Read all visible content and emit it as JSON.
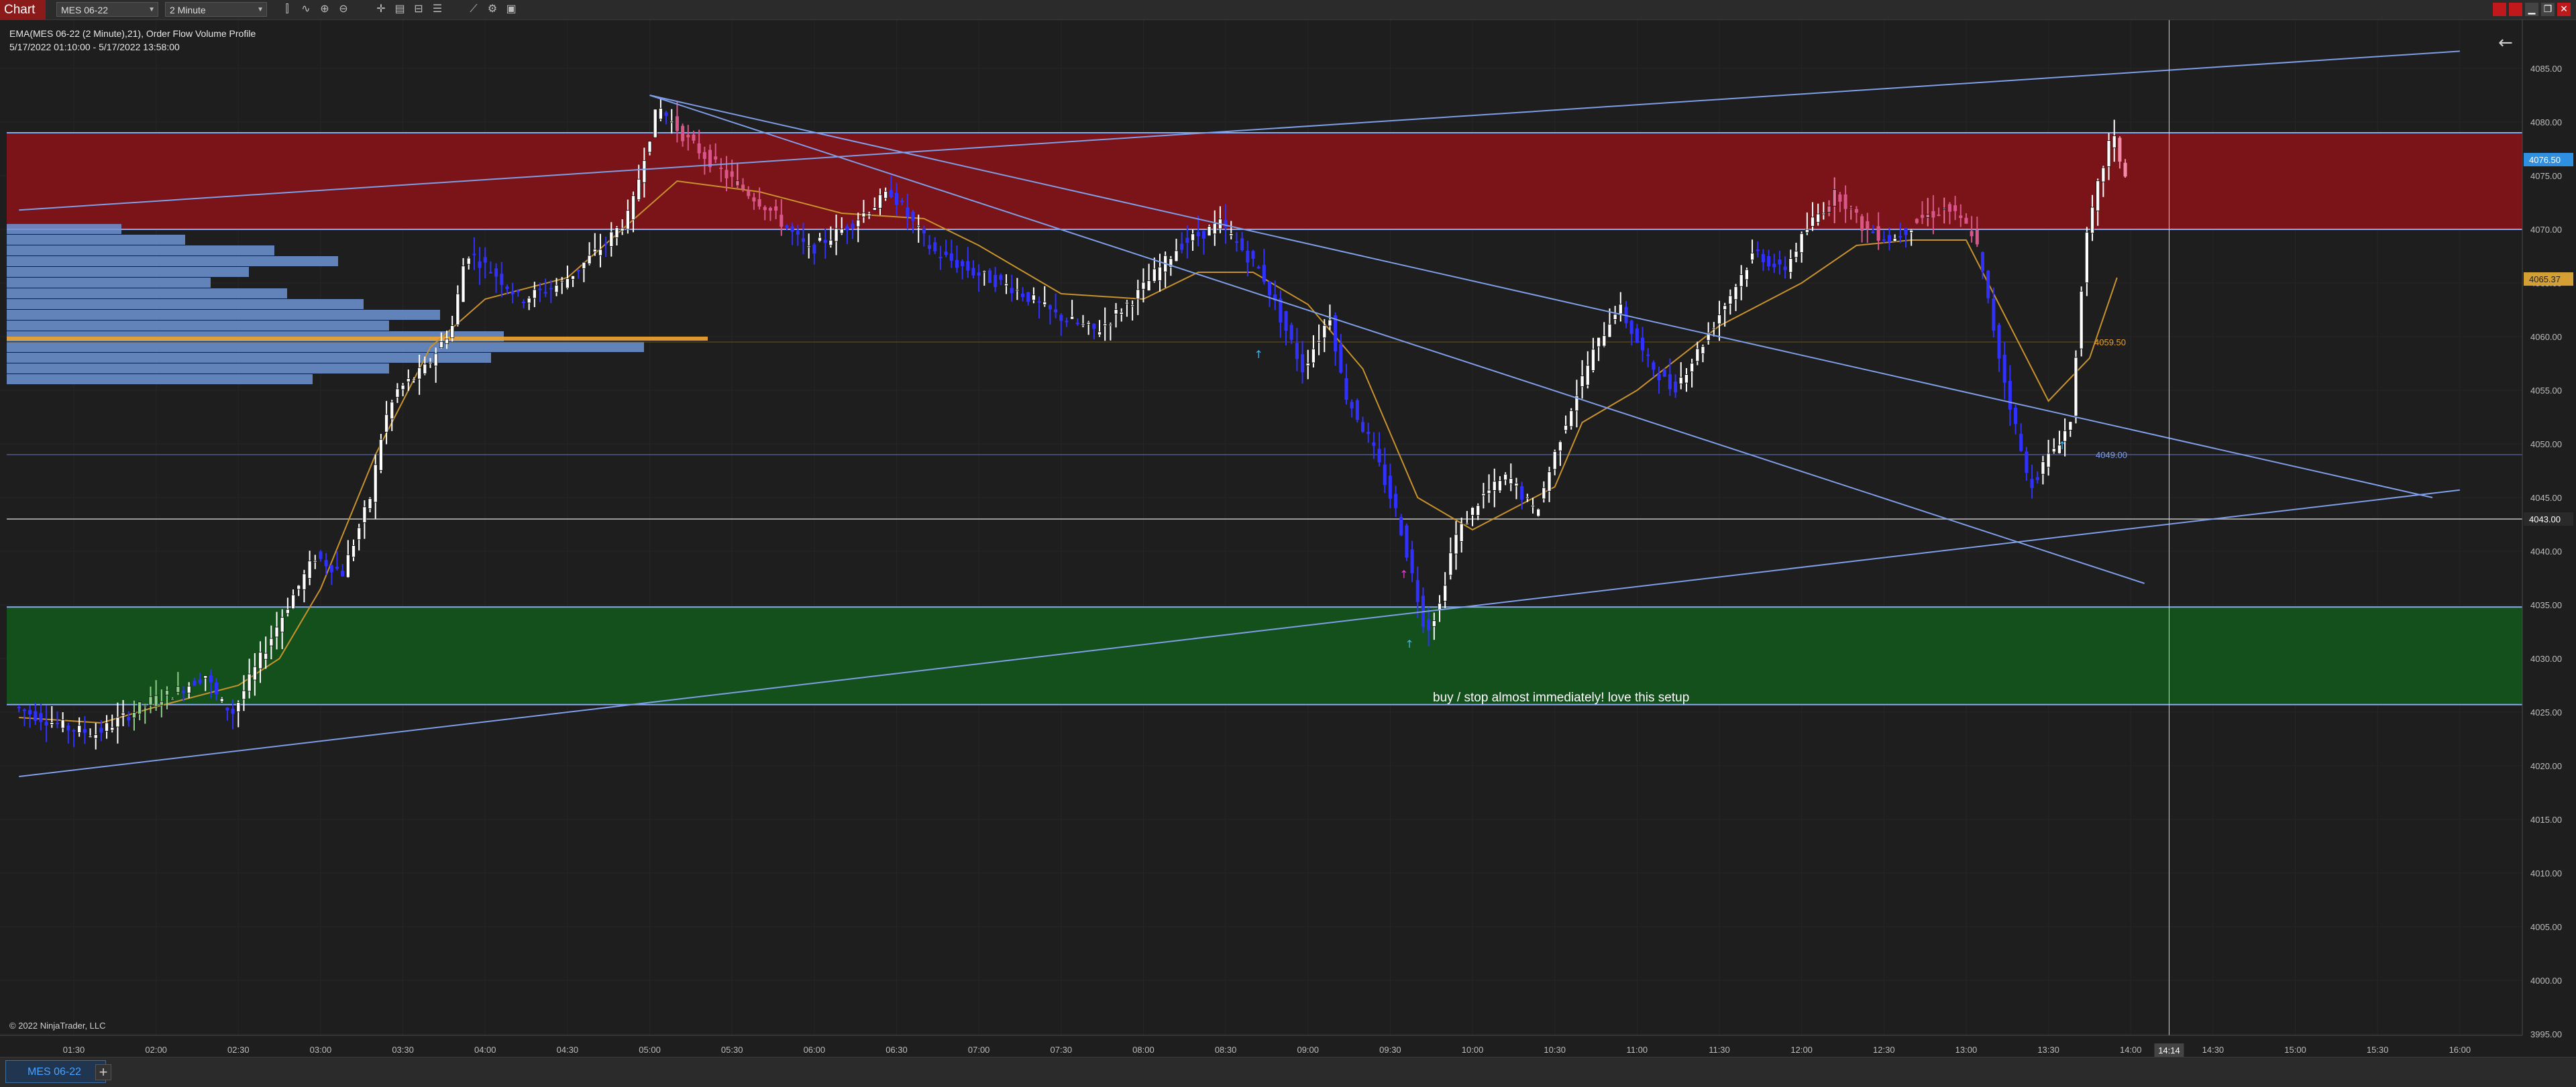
{
  "window": {
    "title": "Chart",
    "instrument": "MES 06-22",
    "interval": "2 Minute"
  },
  "toolbar": {
    "icons": [
      "bar-type-icon",
      "indicators-icon",
      "zoom-in-icon",
      "zoom-out-icon",
      "crosshair-icon",
      "data-box-icon",
      "draw-objects-icon",
      "properties-icon",
      "strategy-icon",
      "templates-icon",
      "snapshot-icon"
    ]
  },
  "chart": {
    "indicator_label": "EMA(MES 06-22 (2 Minute),21), Order Flow Volume Profile",
    "date_range": "5/17/2022 01:10:00 - 5/17/2022 13:58:00",
    "copyright": "© 2022 NinjaTrader, LLC",
    "annotation": "buy / stop almost immediately!  love this setup",
    "colors": {
      "background": "#1e1e1e",
      "bull_candle": "#ffffff",
      "bear_candle": "#3030ff",
      "resistance_zone": "#7a1418",
      "support_zone": "#14501c",
      "trendline": "#7f9ee8",
      "ema": "#c8922c",
      "volume_profile": "#6e94d6",
      "poc": "#e8a030"
    },
    "price_axis": {
      "labels": [
        "4085.00",
        "4080.00",
        "4075.00",
        "4070.00",
        "4065.00",
        "4060.00",
        "4055.00",
        "4050.00",
        "4045.00",
        "4040.00",
        "4035.00",
        "4030.00",
        "4025.00",
        "4020.00",
        "4015.00",
        "4010.00",
        "4005.00",
        "4000.00",
        "3995.00"
      ],
      "current_price": "4076.50",
      "ema_value": "4065.37",
      "level_price": "4043.00"
    },
    "time_axis": {
      "labels": [
        "01:30",
        "02:00",
        "02:30",
        "03:00",
        "03:30",
        "04:00",
        "04:30",
        "05:00",
        "05:30",
        "06:00",
        "06:30",
        "07:00",
        "07:30",
        "08:00",
        "08:30",
        "09:00",
        "09:30",
        "10:00",
        "10:30",
        "11:00",
        "11:30",
        "12:00",
        "12:30",
        "13:00",
        "13:30",
        "14:00",
        "14:30",
        "15:00",
        "15:30",
        "16:00"
      ],
      "cursor_time": "14:14"
    },
    "price_markers": [
      "4059.50",
      "4049.00"
    ],
    "zones": [
      {
        "name": "resistance",
        "from": 4070.0,
        "to": 4079.0
      },
      {
        "name": "support",
        "from": 4025.7,
        "to": 4034.8
      }
    ],
    "horizontal_levels": [
      4049.0,
      4043.0
    ],
    "trendlines": [
      {
        "from": [
          "01:10",
          4071.8
        ],
        "to": [
          "16:00",
          4086.6
        ]
      },
      {
        "from": [
          "01:10",
          4019.0
        ],
        "to": [
          "16:00",
          4045.7
        ]
      },
      {
        "from": [
          "05:00",
          4082.5
        ],
        "to": [
          "15:50",
          4045.0
        ]
      },
      {
        "from": [
          "05:00",
          4082.5
        ],
        "to": [
          "14:05",
          4037.0
        ]
      }
    ],
    "ema_path": [
      [
        "01:10",
        4024.5
      ],
      [
        "01:40",
        4024.0
      ],
      [
        "02:00",
        4025.5
      ],
      [
        "02:30",
        4027.5
      ],
      [
        "02:45",
        4030.0
      ],
      [
        "03:00",
        4036.5
      ],
      [
        "03:20",
        4049.0
      ],
      [
        "03:40",
        4059.0
      ],
      [
        "04:00",
        4063.5
      ],
      [
        "04:30",
        4065.5
      ],
      [
        "04:50",
        4070.0
      ],
      [
        "05:10",
        4074.5
      ],
      [
        "05:40",
        4073.5
      ],
      [
        "06:10",
        4071.5
      ],
      [
        "06:40",
        4071.0
      ],
      [
        "07:00",
        4068.5
      ],
      [
        "07:30",
        4064.0
      ],
      [
        "08:00",
        4063.5
      ],
      [
        "08:20",
        4066.0
      ],
      [
        "08:40",
        4066.0
      ],
      [
        "09:00",
        4063.0
      ],
      [
        "09:20",
        4057.0
      ],
      [
        "09:40",
        4045.0
      ],
      [
        "10:00",
        4042.0
      ],
      [
        "10:30",
        4046.0
      ],
      [
        "10:40",
        4052.0
      ],
      [
        "11:00",
        4055.0
      ],
      [
        "11:30",
        4061.0
      ],
      [
        "12:00",
        4065.0
      ],
      [
        "12:20",
        4068.5
      ],
      [
        "12:40",
        4069.0
      ],
      [
        "13:00",
        4069.0
      ],
      [
        "13:10",
        4064.0
      ],
      [
        "13:30",
        4054.0
      ],
      [
        "13:45",
        4058.0
      ],
      [
        "13:55",
        4065.5
      ]
    ],
    "price_path": [
      [
        "01:10",
        4025.5
      ],
      [
        "01:20",
        4024.5
      ],
      [
        "01:30",
        4023.5
      ],
      [
        "01:40",
        4023.0
      ],
      [
        "01:50",
        4024.5
      ],
      [
        "02:00",
        4026.0
      ],
      [
        "02:10",
        4027.0
      ],
      [
        "02:20",
        4028.5
      ],
      [
        "02:25",
        4026.0
      ],
      [
        "02:30",
        4025.0
      ],
      [
        "02:40",
        4030.0
      ],
      [
        "02:50",
        4035.0
      ],
      [
        "03:00",
        4039.5
      ],
      [
        "03:10",
        4038.0
      ],
      [
        "03:20",
        4045.0
      ],
      [
        "03:25",
        4052.0
      ],
      [
        "03:30",
        4055.0
      ],
      [
        "03:40",
        4057.0
      ],
      [
        "03:50",
        4061.0
      ],
      [
        "03:55",
        4068.0
      ],
      [
        "04:05",
        4066.0
      ],
      [
        "04:15",
        4063.5
      ],
      [
        "04:30",
        4065.0
      ],
      [
        "04:45",
        4068.5
      ],
      [
        "04:55",
        4071.5
      ],
      [
        "05:00",
        4077.0
      ],
      [
        "05:05",
        4081.5
      ],
      [
        "05:15",
        4078.5
      ],
      [
        "05:30",
        4075.0
      ],
      [
        "05:45",
        4072.0
      ],
      [
        "06:00",
        4068.0
      ],
      [
        "06:15",
        4070.5
      ],
      [
        "06:30",
        4073.5
      ],
      [
        "06:45",
        4068.0
      ],
      [
        "07:00",
        4066.0
      ],
      [
        "07:15",
        4064.5
      ],
      [
        "07:30",
        4062.0
      ],
      [
        "07:45",
        4060.5
      ],
      [
        "08:00",
        4064.0
      ],
      [
        "08:15",
        4068.5
      ],
      [
        "08:30",
        4070.5
      ],
      [
        "08:45",
        4066.0
      ],
      [
        "09:00",
        4057.0
      ],
      [
        "09:10",
        4062.0
      ],
      [
        "09:15",
        4055.0
      ],
      [
        "09:25",
        4050.0
      ],
      [
        "09:35",
        4043.0
      ],
      [
        "09:45",
        4032.5
      ],
      [
        "09:50",
        4035.0
      ],
      [
        "09:55",
        4041.0
      ],
      [
        "10:05",
        4045.0
      ],
      [
        "10:15",
        4047.0
      ],
      [
        "10:25",
        4043.5
      ],
      [
        "10:35",
        4051.5
      ],
      [
        "10:45",
        4058.0
      ],
      [
        "10:55",
        4063.0
      ],
      [
        "11:05",
        4058.0
      ],
      [
        "11:15",
        4055.0
      ],
      [
        "11:25",
        4059.0
      ],
      [
        "11:35",
        4063.5
      ],
      [
        "11:45",
        4068.0
      ],
      [
        "11:55",
        4066.0
      ],
      [
        "12:05",
        4070.5
      ],
      [
        "12:15",
        4073.5
      ],
      [
        "12:25",
        4070.0
      ],
      [
        "12:35",
        4069.0
      ],
      [
        "12:45",
        4071.0
      ],
      [
        "12:55",
        4072.0
      ],
      [
        "13:05",
        4069.5
      ],
      [
        "13:15",
        4057.0
      ],
      [
        "13:25",
        4046.0
      ],
      [
        "13:35",
        4050.0
      ],
      [
        "13:40",
        4052.0
      ],
      [
        "13:45",
        4068.0
      ],
      [
        "13:50",
        4074.0
      ],
      [
        "13:55",
        4079.0
      ],
      [
        "14:00",
        4075.0
      ]
    ],
    "volume_profile": [
      {
        "price": 4070.0,
        "vol": 0.09
      },
      {
        "price": 4069.0,
        "vol": 0.14
      },
      {
        "price": 4068.0,
        "vol": 0.21
      },
      {
        "price": 4067.0,
        "vol": 0.26
      },
      {
        "price": 4066.0,
        "vol": 0.19
      },
      {
        "price": 4065.0,
        "vol": 0.16
      },
      {
        "price": 4064.0,
        "vol": 0.22
      },
      {
        "price": 4063.0,
        "vol": 0.28
      },
      {
        "price": 4062.0,
        "vol": 0.34
      },
      {
        "price": 4061.0,
        "vol": 0.3
      },
      {
        "price": 4060.0,
        "vol": 0.39
      },
      {
        "price": 4059.5,
        "vol": 0.55
      },
      {
        "price": 4059.0,
        "vol": 0.5
      },
      {
        "price": 4058.0,
        "vol": 0.38
      },
      {
        "price": 4057.0,
        "vol": 0.3
      },
      {
        "price": 4056.0,
        "vol": 0.24
      }
    ]
  },
  "tabs": [
    {
      "label": "MES 06-22"
    }
  ],
  "add_tab": "+"
}
